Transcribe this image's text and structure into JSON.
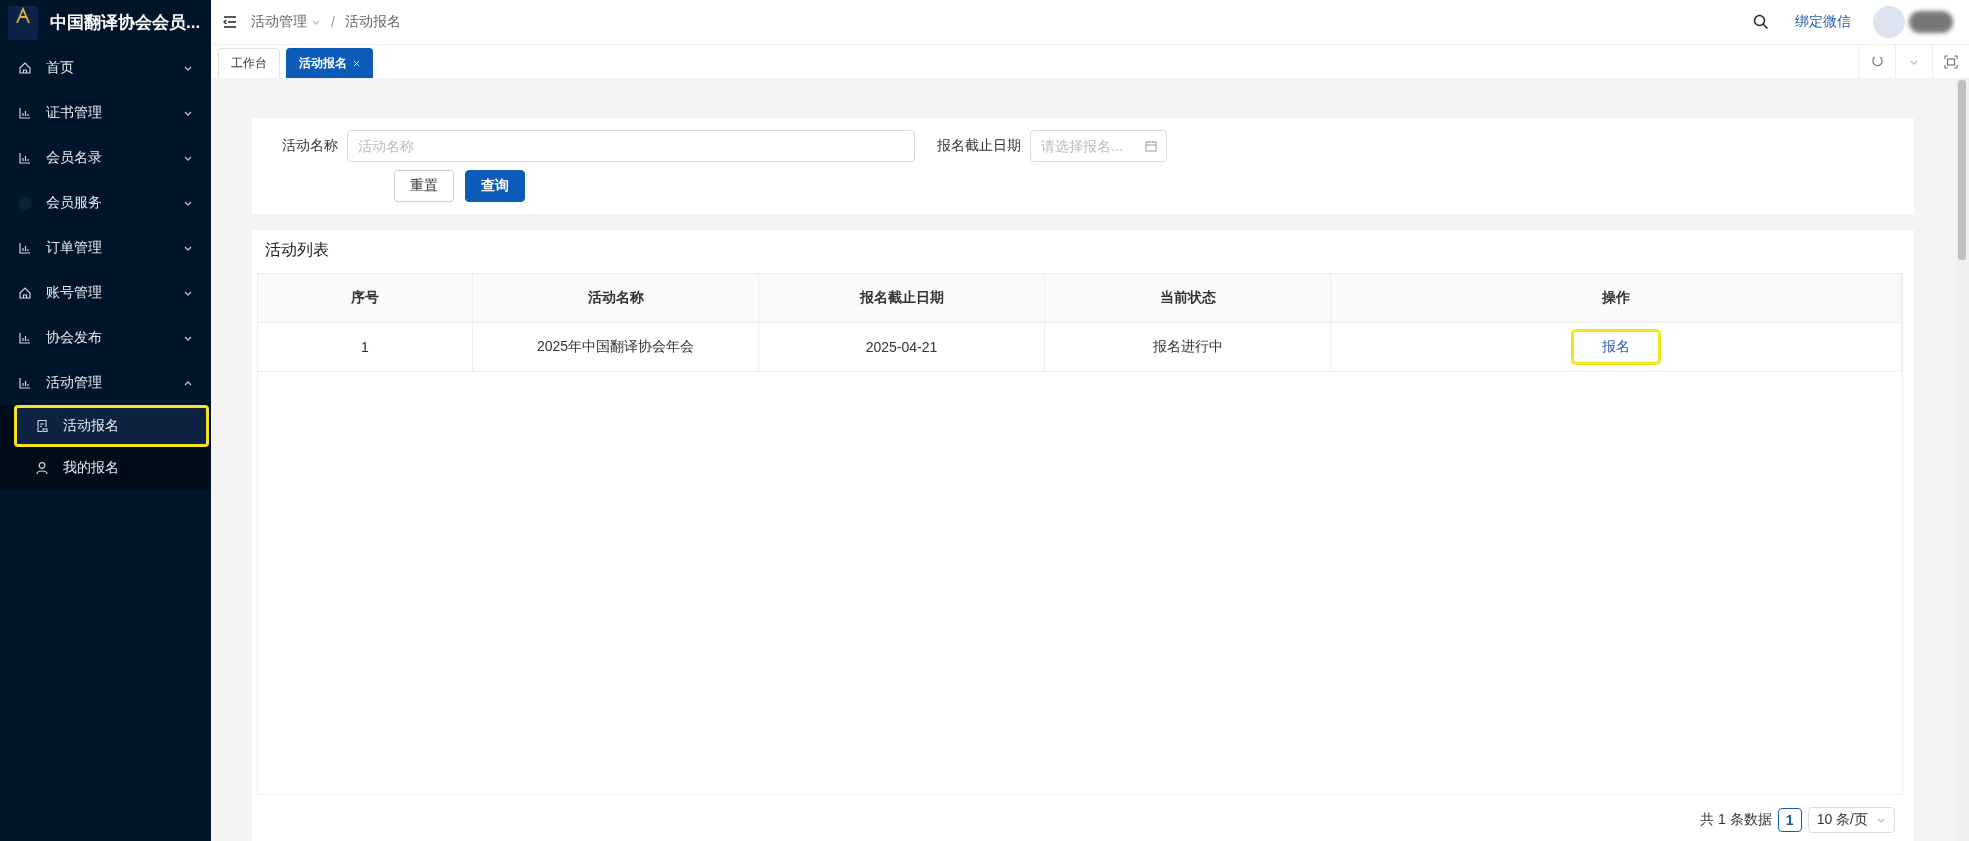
{
  "sidebar": {
    "title": "中国翻译协会会员...",
    "items": [
      {
        "label": "首页",
        "kind": "home",
        "expanded": false
      },
      {
        "label": "证书管理",
        "kind": "chart",
        "expanded": false
      },
      {
        "label": "会员名录",
        "kind": "chart",
        "expanded": false
      },
      {
        "label": "会员服务",
        "kind": "dot",
        "expanded": false
      },
      {
        "label": "订单管理",
        "kind": "chart",
        "expanded": false
      },
      {
        "label": "账号管理",
        "kind": "home",
        "expanded": false
      },
      {
        "label": "协会发布",
        "kind": "chart",
        "expanded": false
      },
      {
        "label": "活动管理",
        "kind": "chart",
        "expanded": true,
        "children": [
          {
            "label": "活动报名",
            "kind": "form",
            "selected": true,
            "highlighted": true
          },
          {
            "label": "我的报名",
            "kind": "user",
            "selected": false,
            "highlighted": false
          }
        ]
      }
    ]
  },
  "header": {
    "breadcrumb": [
      {
        "label": "活动管理",
        "dropdown": true
      },
      {
        "label": "活动报名",
        "dropdown": false
      }
    ],
    "separator": "/",
    "bind_link": "绑定微信"
  },
  "tabs": [
    {
      "label": "工作台",
      "selected": false,
      "closable": false
    },
    {
      "label": "活动报名",
      "selected": true,
      "closable": true
    }
  ],
  "search_form": {
    "fields": [
      {
        "label": "活动名称",
        "placeholder": "活动名称",
        "kind": "text"
      },
      {
        "label": "报名截止日期",
        "placeholder": "请选择报名...",
        "kind": "date"
      }
    ],
    "buttons": [
      {
        "label": "重置",
        "primary": false
      },
      {
        "label": "查询",
        "primary": true
      }
    ]
  },
  "list": {
    "title": "活动列表",
    "columns": [
      "序号",
      "活动名称",
      "报名截止日期",
      "当前状态",
      "操作"
    ],
    "rows": [
      {
        "cells": [
          "1",
          "2025年中国翻译协会年会",
          "2025-04-21",
          "报名进行中"
        ],
        "action": "报名",
        "highlighted": true
      }
    ]
  },
  "pagination": {
    "total": "共 1 条数据",
    "pages": [
      {
        "label": "1",
        "selected": true
      }
    ],
    "page_size": "10 条/页"
  }
}
